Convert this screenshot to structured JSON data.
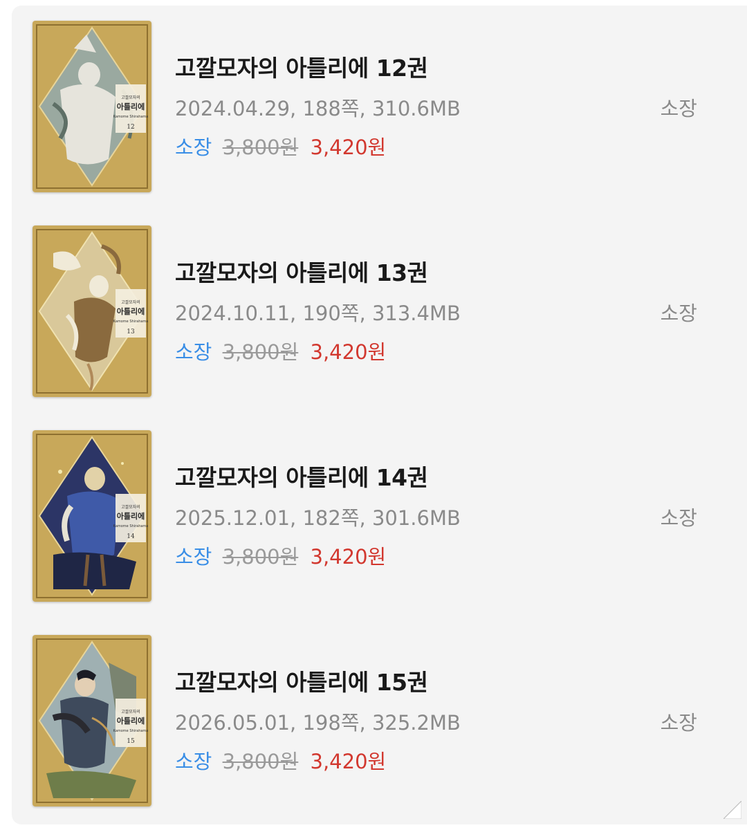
{
  "books": [
    {
      "title": "고깔모자의 아틀리에 12권",
      "meta": "2024.04.29, 188쪽, 310.6MB",
      "price_label": "소장",
      "original_price": "3,800원",
      "sale_price": "3,420원",
      "action_label": "소장",
      "cover_title": "아틀리에",
      "cover_author": "Kamome Shirahama",
      "cover_volume": "12",
      "cover_colors": {
        "sky": "#9aa9a0",
        "figure": "#e6e4dc",
        "accent": "#5e6f66"
      }
    },
    {
      "title": "고깔모자의 아틀리에 13권",
      "meta": "2024.10.11, 190쪽, 313.4MB",
      "price_label": "소장",
      "original_price": "3,800원",
      "sale_price": "3,420원",
      "action_label": "소장",
      "cover_title": "아틀리에",
      "cover_author": "Kamome Shirahama",
      "cover_volume": "13",
      "cover_colors": {
        "sky": "#d9c89a",
        "figure": "#f0ead8",
        "accent": "#8a6a3e"
      }
    },
    {
      "title": "고깔모자의 아틀리에 14권",
      "meta": "2025.12.01, 182쪽, 301.6MB",
      "price_label": "소장",
      "original_price": "3,800원",
      "sale_price": "3,420원",
      "action_label": "소장",
      "cover_title": "아틀리에",
      "cover_author": "Kamome Shirahama",
      "cover_volume": "14",
      "cover_colors": {
        "sky": "#2c3566",
        "figure": "#3f5aa8",
        "accent": "#c9b36a"
      }
    },
    {
      "title": "고깔모자의 아틀리에 15권",
      "meta": "2026.05.01, 198쪽, 325.2MB",
      "price_label": "소장",
      "original_price": "3,800원",
      "sale_price": "3,420원",
      "action_label": "소장",
      "cover_title": "아틀리에",
      "cover_author": "Kamome Shirahama",
      "cover_volume": "15",
      "cover_colors": {
        "sky": "#9fb0b2",
        "figure": "#3e4a5c",
        "accent": "#6e7d4a"
      }
    }
  ],
  "colors": {
    "panel_bg": "#f4f4f4",
    "title": "#1a1a1a",
    "meta": "#8a8a8a",
    "price_label": "#3a8ee6",
    "sale_price": "#d2382f",
    "original_price": "#9a9a9a",
    "cover_frame": "#c8a85a"
  }
}
